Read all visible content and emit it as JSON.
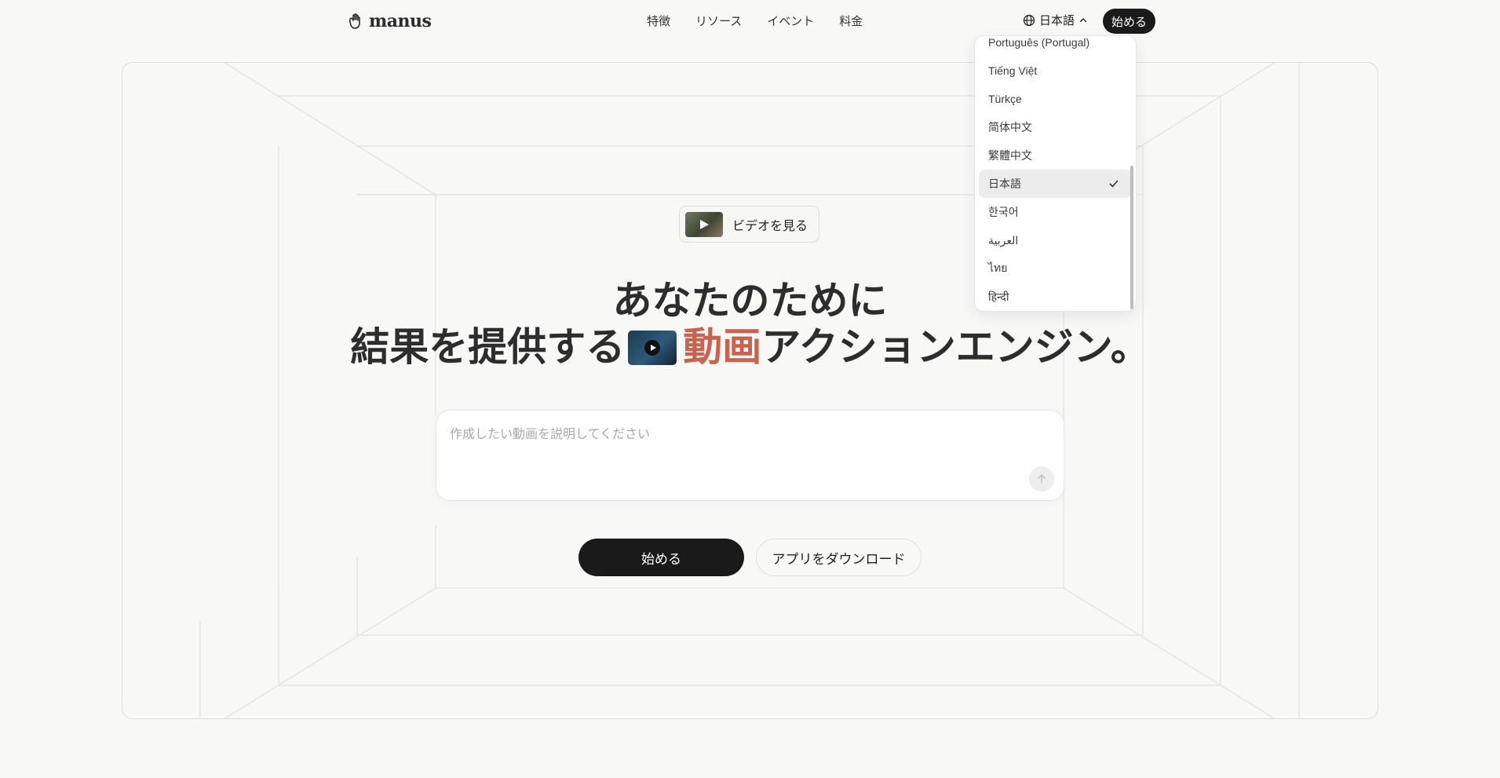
{
  "header": {
    "logo_text": "manus",
    "nav": [
      "特徴",
      "リソース",
      "イベント",
      "料金"
    ],
    "language_label": "日本語",
    "start_label": "始める"
  },
  "hero": {
    "video_chip_label": "ビデオを見る",
    "headline_line1": "あなたのために",
    "headline_line2_pre": "結果を提供する",
    "headline_line2_accent": "動画",
    "headline_line2_post": "アクションエンジン。",
    "prompt_placeholder": "作成したい動画を説明してください",
    "primary_button": "始める",
    "secondary_button": "アプリをダウンロード"
  },
  "language_menu": {
    "items": [
      {
        "label": "Português (Portugal)",
        "selected": false
      },
      {
        "label": "Tiếng Việt",
        "selected": false
      },
      {
        "label": "Türkçe",
        "selected": false
      },
      {
        "label": "简体中文",
        "selected": false
      },
      {
        "label": "繁體中文",
        "selected": false
      },
      {
        "label": "日本語",
        "selected": true
      },
      {
        "label": "한국어",
        "selected": false
      },
      {
        "label": "العربية",
        "selected": false
      },
      {
        "label": "ไทย",
        "selected": false
      },
      {
        "label": "हिन्दी",
        "selected": false
      }
    ]
  }
}
